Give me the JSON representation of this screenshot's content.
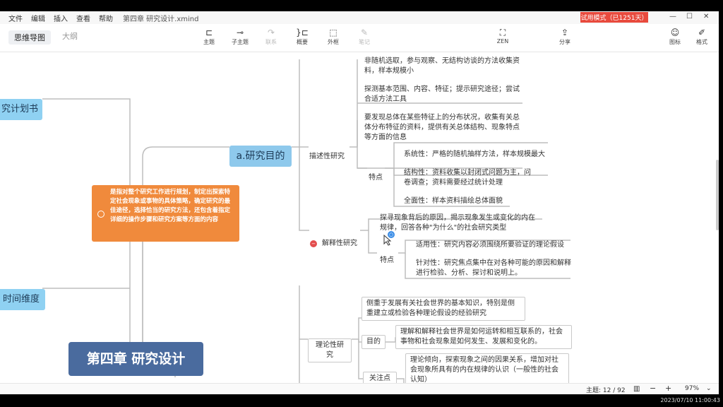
{
  "menu": {
    "items": [
      "文件",
      "编辑",
      "插入",
      "查看",
      "帮助"
    ],
    "document_title": "第四章 研究设计.xmind",
    "trial_badge": "试用模式（已1251天）"
  },
  "toolbar": {
    "tabs": [
      "思维导图",
      "大纲"
    ],
    "tools": [
      {
        "label": "主题",
        "icon": "topic-icon"
      },
      {
        "label": "子主题",
        "icon": "subtopic-icon"
      },
      {
        "label": "联系",
        "icon": "relationship-icon"
      },
      {
        "label": "概要",
        "icon": "summary-icon"
      },
      {
        "label": "外框",
        "icon": "boundary-icon"
      },
      {
        "label": "笔记",
        "icon": "note-icon"
      },
      {
        "label": "ZEN",
        "icon": "zen-icon"
      },
      {
        "label": "分享",
        "icon": "share-icon"
      },
      {
        "label": "图标",
        "icon": "emoji-icon"
      },
      {
        "label": "格式",
        "icon": "format-icon"
      }
    ]
  },
  "mindmap": {
    "left_topics": [
      "究计划书",
      "时间维度"
    ],
    "central_topic": "第四章 研究设计",
    "purpose_topic": "a.研究目的",
    "definition_note": "是指对整个研究工作进行规划，制定出探索特定社会现象或事物的具体策略，确定研究的最佳途径，选择恰当的研究方法，还包含着指定详细的操作步骤和研究方案等方面的内容",
    "exploratory": {
      "item1": "非随机选取，参与观察、无结构访谈的方法收集资料，样本规模小",
      "item2": "探测基本范围、内容、特征；提示研究途径；尝试合适方法工具"
    },
    "descriptive": {
      "label": "描述性研究",
      "summary": "要发现总体在某些特征上的分布状况，收集有关总体分布特征的资料，提供有关总体结构、现象特点等方面的信息",
      "features_label": "特点",
      "features": [
        "系统性：严格的随机抽样方法，样本规模最大",
        "结构性：资料收集以封闭式问题为主，问卷调查；资料需要经过统计处理",
        "全面性：样本资料描绘总体面貌"
      ]
    },
    "explanatory": {
      "label": "解释性研究",
      "summary": "探寻现象背后的原因，揭示现象发生或变化的内在规律，回答各种\"为什么\"的社会研究类型",
      "features_label": "特点",
      "features": [
        "适用性：研究内容必须围绕所要验证的理论假设",
        "针对性：研究焦点集中在对各种可能的原因和解释进行检验、分析、探讨和说明上。"
      ]
    },
    "theoretical": {
      "label": "理论性研究",
      "summary": "侧重于发展有关社会世界的基本知识，特别是侧重建立或检验各种理论假设的经验研究",
      "goal_label": "目的",
      "goal": "理解和解释社会世界是如何运转和相互联系的，社会事物和社会现象是如何发生、发展和变化的。",
      "focus_label": "关注点",
      "focus": "理论倾向，探索现象之间的因果关系，增加对社会现象所具有的内在规律的认识（一般性的社会认知）"
    }
  },
  "status": {
    "topic_count": "主题: 12 / 92",
    "zoom_minus": "−",
    "zoom_plus": "+",
    "zoom": "97%"
  },
  "clock": "2023/07/10 11:00:43"
}
